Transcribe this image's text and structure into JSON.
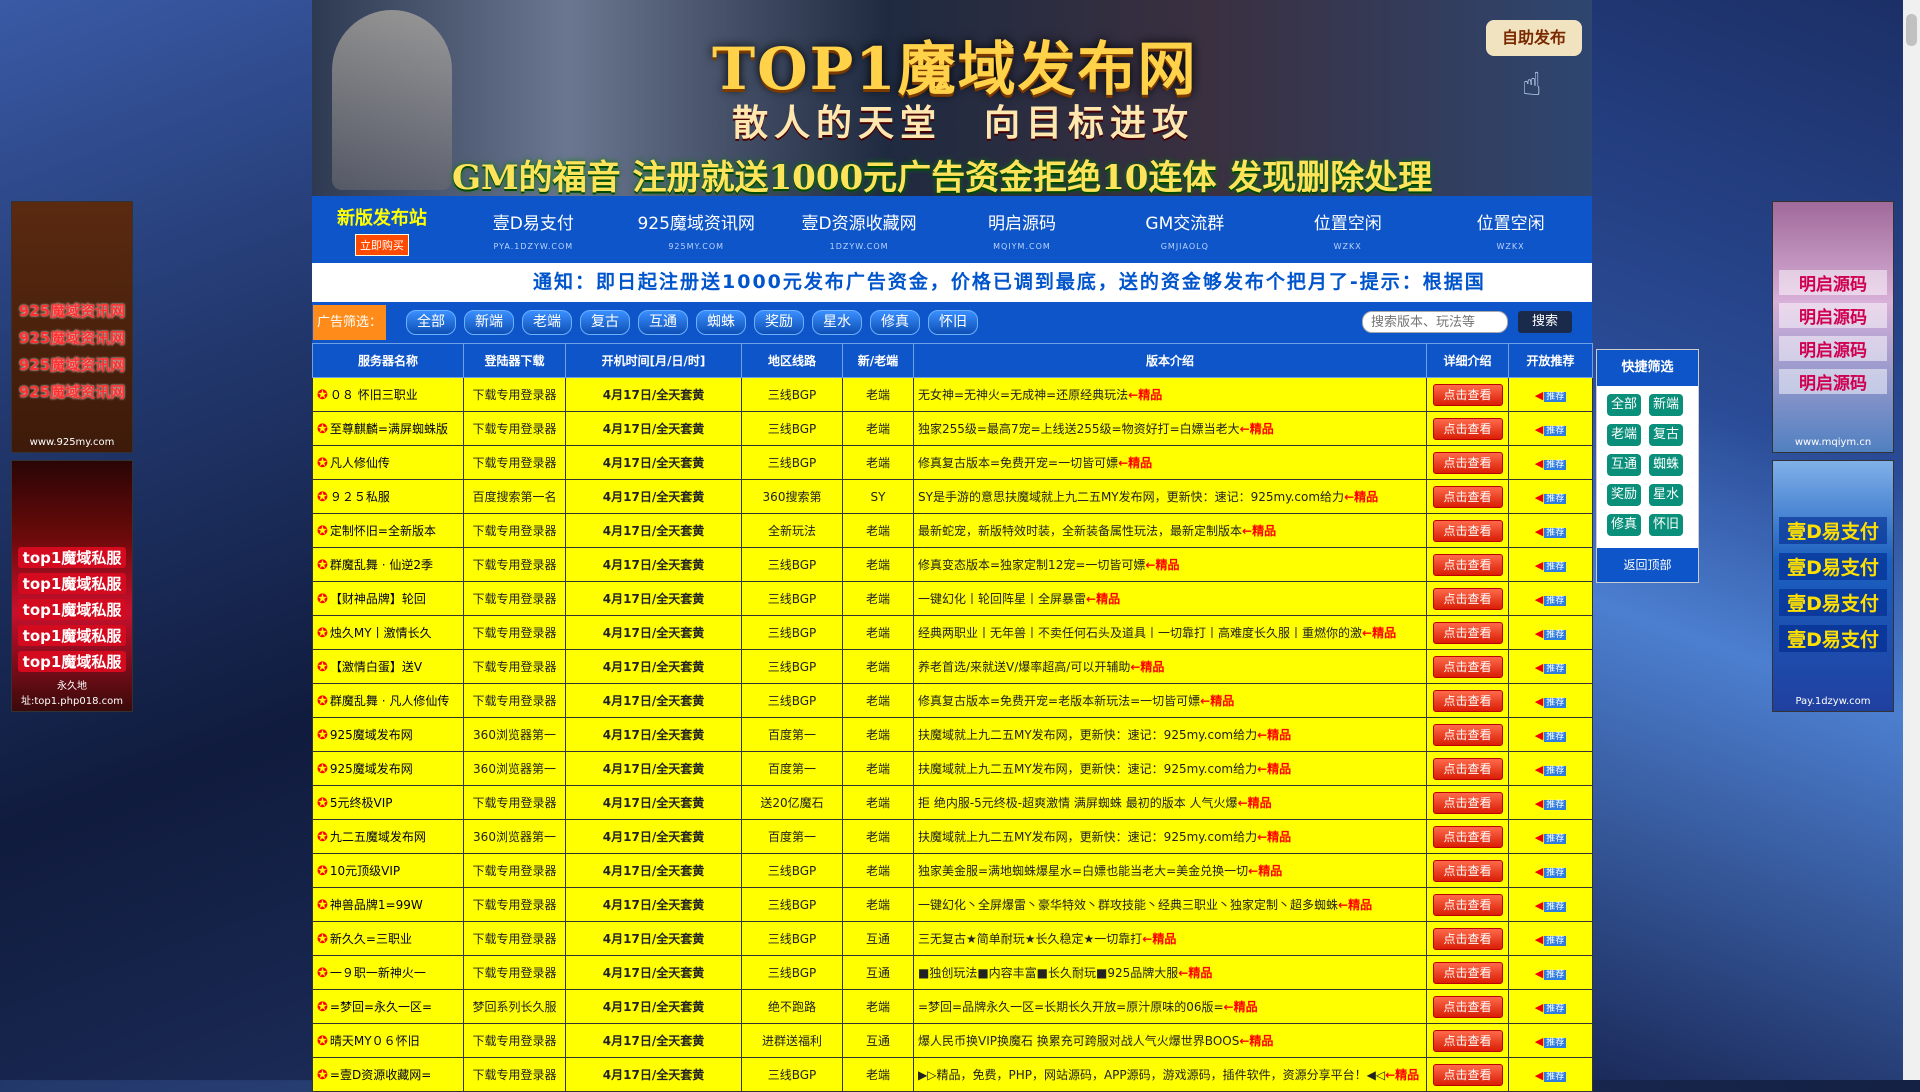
{
  "banner": {
    "title": "TOP1魔域发布网",
    "slogan": "散人的天堂　向目标进攻",
    "gm_line": "GM的福音 注册就送1000元广告资金拒绝10连体 发现删除处理",
    "self_publish": "自助发布"
  },
  "nav": {
    "new_site": "新版发布站",
    "buy": "立即购买",
    "items": [
      {
        "title": "壹D易支付",
        "sub": "PYA.1DZYW.COM"
      },
      {
        "title": "925魔域资讯网",
        "sub": "925MY.COM"
      },
      {
        "title": "壹D资源收藏网",
        "sub": "1DZYW.COM"
      },
      {
        "title": "明启源码",
        "sub": "MQIYM.COM"
      },
      {
        "title": "GM交流群",
        "sub": "GMJIAOLQ"
      },
      {
        "title": "位置空闲",
        "sub": "WZKX"
      },
      {
        "title": "位置空闲",
        "sub": "WZKX"
      }
    ]
  },
  "notice": "通知：即日起注册送1000元发布广告资金，价格已调到最底，送的资金够发布个把月了-提示：根据国",
  "filter": {
    "label": "广告筛选：",
    "buttons": [
      "全部",
      "新端",
      "老端",
      "复古",
      "互通",
      "蜘蛛",
      "奖励",
      "星水",
      "修真",
      "怀旧"
    ],
    "search_placeholder": "搜索版本、玩法等",
    "search_button": "搜索"
  },
  "table": {
    "headers": [
      "服务器名称",
      "登陆器下载",
      "开机时间[月/日/时]",
      "地区线路",
      "新/老端",
      "版本介绍",
      "详细介绍",
      "开放推荐"
    ],
    "detail_label": "点击查看",
    "rec_label": "推荐",
    "rows": [
      {
        "name": "０８ 怀旧三职业",
        "dl": "下载专用登录器",
        "time": "4月17日/全天套黄",
        "line": "三线BGP",
        "type": "老端",
        "desc": "无女神=无神火=无成神=还原经典玩法",
        "hot": "←精品"
      },
      {
        "name": "至尊麒麟=满屏蜘蛛版",
        "dl": "下载专用登录器",
        "time": "4月17日/全天套黄",
        "line": "三线BGP",
        "type": "老端",
        "desc": "独家255级=最高7宠=上线送255级=物资好打=白嫖当老大",
        "hot": "←精品"
      },
      {
        "name": "凡人修仙传",
        "dl": "下载专用登录器",
        "time": "4月17日/全天套黄",
        "line": "三线BGP",
        "type": "老端",
        "desc": "修真复古版本=免费开宠=一切皆可嫖",
        "hot": "←精品"
      },
      {
        "name": "９２５私服",
        "dl": "百度搜索第一名",
        "time": "4月17日/全天套黄",
        "line": "360搜索第",
        "type": "SY",
        "desc": "SY是手游的意思扶魔域就上九二五MY发布网，更新快：速记：925my.com给力",
        "hot": "←精品"
      },
      {
        "name": "定制怀旧=全新版本",
        "dl": "下载专用登录器",
        "time": "4月17日/全天套黄",
        "line": "全新玩法",
        "type": "老端",
        "desc": "最新蛇宠，新版特效时装，全新装备属性玩法，最新定制版本",
        "hot": "←精品"
      },
      {
        "name": "群魔乱舞 · 仙逆2季",
        "dl": "下载专用登录器",
        "time": "4月17日/全天套黄",
        "line": "三线BGP",
        "type": "老端",
        "desc": "修真变态版本=独家定制12宠=一切皆可嫖",
        "hot": "←精品"
      },
      {
        "name": "【财神品牌】轮回",
        "dl": "下载专用登录器",
        "time": "4月17日/全天套黄",
        "line": "三线BGP",
        "type": "老端",
        "desc": "一键幻化丨轮回阵星丨全屏暴雷",
        "hot": "←精品"
      },
      {
        "name": "烛久MY丨激情长久",
        "dl": "下载专用登录器",
        "time": "4月17日/全天套黄",
        "line": "三线BGP",
        "type": "老端",
        "desc": "经典两职业丨无年兽丨不卖任何石头及道具丨一切靠打丨高难度长久服丨重燃你的激",
        "hot": "←精品"
      },
      {
        "name": "【激情白蛋】送V",
        "dl": "下载专用登录器",
        "time": "4月17日/全天套黄",
        "line": "三线BGP",
        "type": "老端",
        "desc": "养老首选/来就送V/爆率超高/可以开辅助",
        "hot": "←精品"
      },
      {
        "name": "群魔乱舞 · 凡人修仙传",
        "dl": "下载专用登录器",
        "time": "4月17日/全天套黄",
        "line": "三线BGP",
        "type": "老端",
        "desc": "修真复古版本=免费开宠=老版本新玩法=一切皆可嫖",
        "hot": "←精品"
      },
      {
        "name": "925魔域发布网",
        "dl": "360浏览器第一",
        "time": "4月17日/全天套黄",
        "line": "百度第一",
        "type": "老端",
        "desc": "扶魔域就上九二五MY发布网，更新快：速记：925my.com给力",
        "hot": "←精品"
      },
      {
        "name": "925魔域发布网",
        "dl": "360浏览器第一",
        "time": "4月17日/全天套黄",
        "line": "百度第一",
        "type": "老端",
        "desc": "扶魔域就上九二五MY发布网，更新快：速记：925my.com给力",
        "hot": "←精品"
      },
      {
        "name": "5元终极VIP",
        "dl": "下载专用登录器",
        "time": "4月17日/全天套黄",
        "line": "送20亿魔石",
        "type": "老端",
        "desc": "拒 绝内服-5元终极-超爽激情 满屏蜘蛛 最初的版本 人气火爆",
        "hot": "←精品"
      },
      {
        "name": "九二五魔域发布网",
        "dl": "360浏览器第一",
        "time": "4月17日/全天套黄",
        "line": "百度第一",
        "type": "老端",
        "desc": "扶魔域就上九二五MY发布网，更新快：速记：925my.com给力",
        "hot": "←精品"
      },
      {
        "name": "10元顶级VIP",
        "dl": "下载专用登录器",
        "time": "4月17日/全天套黄",
        "line": "三线BGP",
        "type": "老端",
        "desc": "独家美金服=满地蜘蛛爆星水=白嫖也能当老大=美金兑换一切",
        "hot": "←精品"
      },
      {
        "name": "神兽品牌1=99W",
        "dl": "下载专用登录器",
        "time": "4月17日/全天套黄",
        "line": "三线BGP",
        "type": "老端",
        "desc": "一键幻化丶全屏爆雷丶豪华特效丶群攻技能丶经典三职业丶独家定制丶超多蜘蛛",
        "hot": "←精品"
      },
      {
        "name": "新久久=三职业",
        "dl": "下载专用登录器",
        "time": "4月17日/全天套黄",
        "line": "三线BGP",
        "type": "互通",
        "desc": "三无复古★简单耐玩★长久稳定★一切靠打",
        "hot": "←精品"
      },
      {
        "name": "一９职一新神火一",
        "dl": "下载专用登录器",
        "time": "4月17日/全天套黄",
        "line": "三线BGP",
        "type": "互通",
        "desc": "■独创玩法■内容丰富■长久耐玩■925品牌大服",
        "hot": "←精品"
      },
      {
        "name": "=梦回=永久一区=",
        "dl": "梦回系列长久服",
        "time": "4月17日/全天套黄",
        "line": "绝不跑路",
        "type": "老端",
        "desc": "=梦回=品牌永久一区=长期长久开放=原汁原味的06版=",
        "hot": "←精品"
      },
      {
        "name": "晴天MY０６怀旧",
        "dl": "下载专用登录器",
        "time": "4月17日/全天套黄",
        "line": "进群送福利",
        "type": "互通",
        "desc": "爆人民币换VIP换魔石 换累充可跨服对战人气火爆世界BOOS",
        "hot": "←精品"
      },
      {
        "name": "=壹D资源收藏网=",
        "dl": "下载专用登录器",
        "time": "4月17日/全天套黄",
        "line": "三线BGP",
        "type": "老端",
        "desc": "▶▷精品，免费，PHP，网站源码，APP源码，游戏源码，插件软件，资源分享平台！◀◁",
        "hot": "←精品"
      }
    ]
  },
  "quick": {
    "title": "快捷筛选",
    "buttons": [
      "全部",
      "新端",
      "老端",
      "复古",
      "互通",
      "蜘蛛",
      "奖励",
      "星水",
      "修真",
      "怀旧"
    ],
    "back_top": "返回顶部"
  },
  "ads": {
    "left_top": [
      "925魔域资讯网",
      "925魔域资讯网",
      "925魔域资讯网",
      "925魔域资讯网"
    ],
    "left_top_foot": "www.925my.com",
    "left_bottom": [
      "top1魔域私服",
      "top1魔域私服",
      "top1魔域私服",
      "top1魔域私服",
      "top1魔域私服"
    ],
    "left_bottom_foot": "永久地址:top1.php018.com",
    "right_top": [
      "明启源码",
      "明启源码",
      "明启源码",
      "明启源码"
    ],
    "right_top_foot": "www.mqiym.cn",
    "right_bottom": [
      "壹D易支付",
      "壹D易支付",
      "壹D易支付",
      "壹D易支付"
    ],
    "right_bottom_foot": "Pay.1dzyw.com"
  }
}
